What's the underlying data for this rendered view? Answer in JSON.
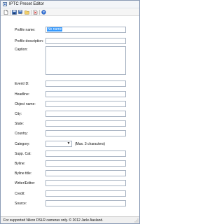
{
  "window": {
    "title": "IPTC Preset Editor",
    "app_icon": "app-icon"
  },
  "toolbar": {
    "buttons": [
      {
        "name": "new-document-icon",
        "color": "#ffffff"
      },
      {
        "name": "save-icon",
        "color": "#3b6fbf"
      },
      {
        "name": "save-as-icon",
        "color": "#3b6fbf"
      },
      {
        "name": "open-icon",
        "color": "#e0b44a"
      },
      {
        "name": "delete-icon",
        "color": "#d23b3b"
      },
      {
        "name": "help-icon",
        "color": "#2f6fd6"
      }
    ]
  },
  "form": {
    "profile_name": {
      "label": "Profile name:",
      "value": "No name"
    },
    "profile_description": {
      "label": "Profile description:",
      "value": ""
    },
    "caption": {
      "label": "Caption:",
      "value": ""
    },
    "event_id": {
      "label": "Event ID:",
      "value": ""
    },
    "headline": {
      "label": "Headline:",
      "value": ""
    },
    "object_name": {
      "label": "Object name:",
      "value": ""
    },
    "city": {
      "label": "City:",
      "value": ""
    },
    "state": {
      "label": "State:",
      "value": ""
    },
    "country": {
      "label": "Country:",
      "value": ""
    },
    "category": {
      "label": "Category:",
      "value": "",
      "hint": "(Max. 3 characters)"
    },
    "supp_cat": {
      "label": "Supp. Cat:",
      "value": ""
    },
    "byline": {
      "label": "Byline:",
      "value": ""
    },
    "byline_title": {
      "label": "Byline title:",
      "value": ""
    },
    "writer_editor": {
      "label": "Writer/Editor:",
      "value": ""
    },
    "credit": {
      "label": "Credit:",
      "value": ""
    },
    "source": {
      "label": "Source:",
      "value": ""
    }
  },
  "status": {
    "text": "For supported Nikon DSLR cameras only. © 2012 Jarle Aasland."
  },
  "colors": {
    "selection": "#3399ff",
    "field_border": "#a9b4c3"
  }
}
